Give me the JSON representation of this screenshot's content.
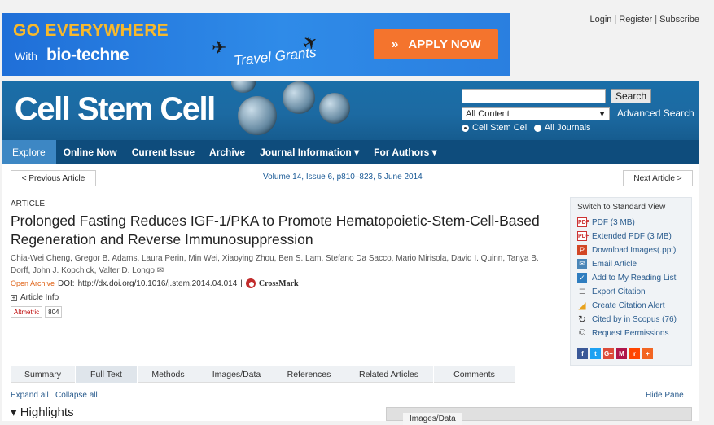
{
  "ad": {
    "headline": "GO EVERYWHERE",
    "with": "With",
    "brand": "bio-techne",
    "tagline": "Travel Grants",
    "cta": "APPLY NOW",
    "cta_icon": "chevrons-right-icon",
    "accent": "#f4742d"
  },
  "top_links": [
    "Login",
    "Register",
    "Subscribe"
  ],
  "journal": {
    "logo": "Cell Stem Cell",
    "search": {
      "value": "",
      "button": "Search",
      "scope": "All Content",
      "advanced": "Advanced Search"
    },
    "radio_options": [
      "Cell Stem Cell",
      "All Journals"
    ],
    "radio_selected": "Cell Stem Cell"
  },
  "nav": [
    "Explore",
    "Online Now",
    "Current Issue",
    "Archive",
    "Journal Information ▾",
    "For Authors ▾"
  ],
  "article": {
    "prev": "< Previous Article",
    "next": "Next Article >",
    "volume": "Volume 14, Issue 6, p810–823, 5 June 2014",
    "type": "ARTICLE",
    "title": "Prolonged Fasting Reduces IGF-1/PKA to Promote Hematopoietic-Stem-Cell-Based Regeneration and Reverse Immunosuppression",
    "authors": "Chia-Wei Cheng, Gregor B. Adams, Laura Perin, Min Wei, Xiaoying Zhou, Ben S. Lam, Stefano Da Sacco, Mario Mirisola, David I. Quinn, Tanya B. Dorff, John J. Kopchick, Valter D. Longo",
    "open_archive": "Open Archive",
    "doi_label": "DOI:",
    "doi": "http://dx.doi.org/10.1016/j.stem.2014.04.014",
    "separator": "|",
    "crossmark": "CrossMark",
    "article_info": "Article Info",
    "altmetric_label": "Altmetric",
    "altmetric_score": "804"
  },
  "tools": {
    "switch": "Switch to Standard View",
    "items": [
      {
        "label": "PDF (3 MB)",
        "icon": "pdf-icon"
      },
      {
        "label": "Extended PDF (3 MB)",
        "icon": "pdf-icon"
      },
      {
        "label": "Download Images(.ppt)",
        "icon": "ppt-icon"
      },
      {
        "label": "Email Article",
        "icon": "email-icon"
      },
      {
        "label": "Add to My Reading List",
        "icon": "reading-list-icon"
      },
      {
        "label": "Export Citation",
        "icon": "export-icon"
      },
      {
        "label": "Create Citation Alert",
        "icon": "alert-icon"
      },
      {
        "label": "Cited by in Scopus (76)",
        "icon": "scopus-icon"
      },
      {
        "label": "Request Permissions",
        "icon": "permissions-icon"
      }
    ],
    "share": [
      {
        "name": "facebook",
        "glyph": "f",
        "color": "#3b5998"
      },
      {
        "name": "twitter",
        "glyph": "t",
        "color": "#1da1f2"
      },
      {
        "name": "google-plus",
        "glyph": "G+",
        "color": "#dd4b39"
      },
      {
        "name": "mendeley",
        "glyph": "M",
        "color": "#b0154a"
      },
      {
        "name": "reddit",
        "glyph": "r",
        "color": "#ff4500"
      },
      {
        "name": "more",
        "glyph": "+",
        "color": "#f26522"
      }
    ]
  },
  "tabs": {
    "items": [
      "Summary",
      "Full Text",
      "Methods",
      "Images/Data",
      "References",
      "Related Articles",
      "Comments"
    ],
    "active": "Full Text"
  },
  "expand_all": "Expand all",
  "collapse_all": "Collapse all",
  "hide_pane": "Hide Pane",
  "highlights": "▾ Highlights",
  "images_pane_label": "Images/Data"
}
